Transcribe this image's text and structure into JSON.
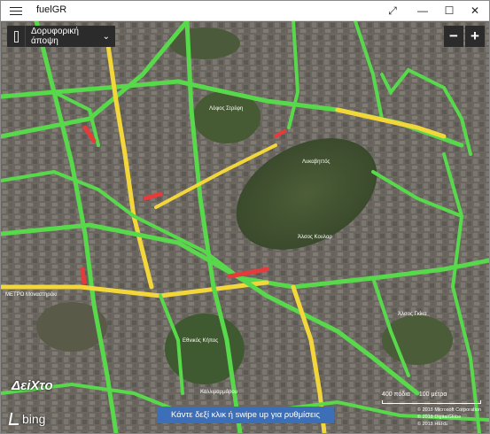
{
  "app": {
    "title": "fuelGR"
  },
  "window": {
    "restore_glyph": "⤢",
    "minimize_glyph": "—",
    "maximize_glyph": "☐",
    "close_glyph": "✕"
  },
  "map": {
    "style_selector": {
      "label": "Δορυφορική άποψη",
      "chevron": "⌄"
    },
    "zoom_out": "−",
    "zoom_in": "+",
    "hint": "Κάντε δεξί κλικ ή swipe up για ρυθμίσεις",
    "scale_left": "400 πόδια",
    "scale_right": "100 μέτρα",
    "copyright": [
      "© 2018 Microsoft Corporation",
      "© 2018 DigitalGlobe",
      "© 2018 HERE"
    ],
    "brand_logo": "ΔεiΧτο",
    "provider": "bing",
    "labels": [
      "Λυκαβηττός",
      "Άλσος Γκίκα",
      "ΜΕΤΡΟ Μοναστηράκι",
      "Λόφος Στρέφη",
      "Άλσος Κουλαρ",
      "Εθνικός Κήπος",
      "Καλλιμαρμάρου"
    ],
    "colors": {
      "traffic_free": "#58d94b",
      "traffic_moderate": "#f3d73a",
      "traffic_heavy": "#e53b3b"
    }
  }
}
